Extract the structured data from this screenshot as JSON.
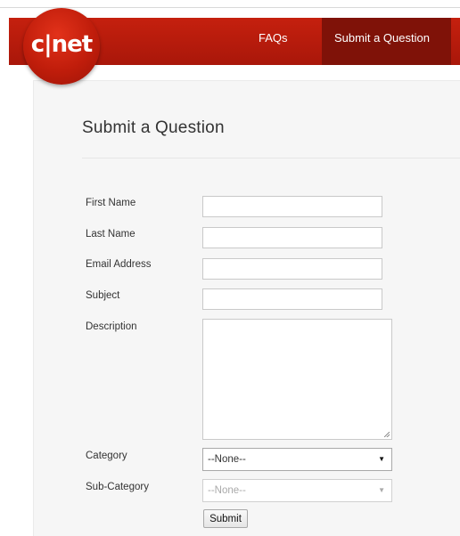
{
  "brand": {
    "logo_text": "c|net"
  },
  "nav": {
    "faqs": "FAQs",
    "submit_question": "Submit a Question",
    "active": "Submit a Question"
  },
  "form": {
    "title": "Submit a Question",
    "fields": {
      "first_name": {
        "label": "First Name",
        "value": ""
      },
      "last_name": {
        "label": "Last Name",
        "value": ""
      },
      "email": {
        "label": "Email Address",
        "value": ""
      },
      "subject": {
        "label": "Subject",
        "value": ""
      },
      "description": {
        "label": "Description",
        "value": ""
      }
    },
    "category": {
      "label": "Category",
      "selected": "--None--"
    },
    "subcategory": {
      "label": "Sub-Category",
      "selected": "--None--",
      "disabled": true
    },
    "submit_label": "Submit"
  },
  "colors": {
    "brand_red": "#c5200e",
    "active_tab": "#7f1208"
  },
  "icons": {
    "select_arrow": "chevron-down-icon",
    "resize": "resize-handle-icon"
  }
}
